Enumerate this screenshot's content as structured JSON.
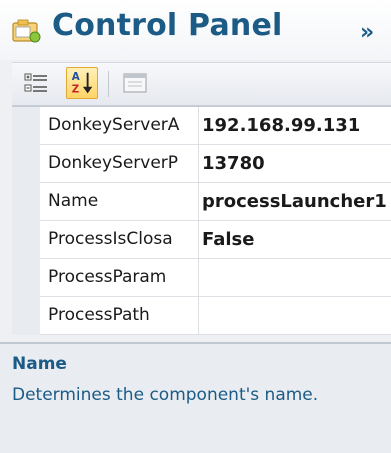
{
  "header": {
    "title": "Control Panel",
    "collapse_glyph": "»",
    "icon": "control-panel-icon"
  },
  "toolbar": {
    "categorized_icon": "categorized-icon",
    "alphabetical_icon": "sort-az-icon",
    "property_pages_icon": "property-pages-icon"
  },
  "properties": [
    {
      "name": "DonkeyServerA",
      "value": "192.168.99.131"
    },
    {
      "name": "DonkeyServerP",
      "value": "13780"
    },
    {
      "name": "Name",
      "value": "processLauncher1"
    },
    {
      "name": "ProcessIsClosa",
      "value": "False"
    },
    {
      "name": "ProcessParam",
      "value": ""
    },
    {
      "name": "ProcessPath",
      "value": ""
    }
  ],
  "description": {
    "title": "Name",
    "text": "Determines the component's name."
  },
  "colors": {
    "accent": "#1b5b86",
    "toggle_active": "#ffd466"
  }
}
